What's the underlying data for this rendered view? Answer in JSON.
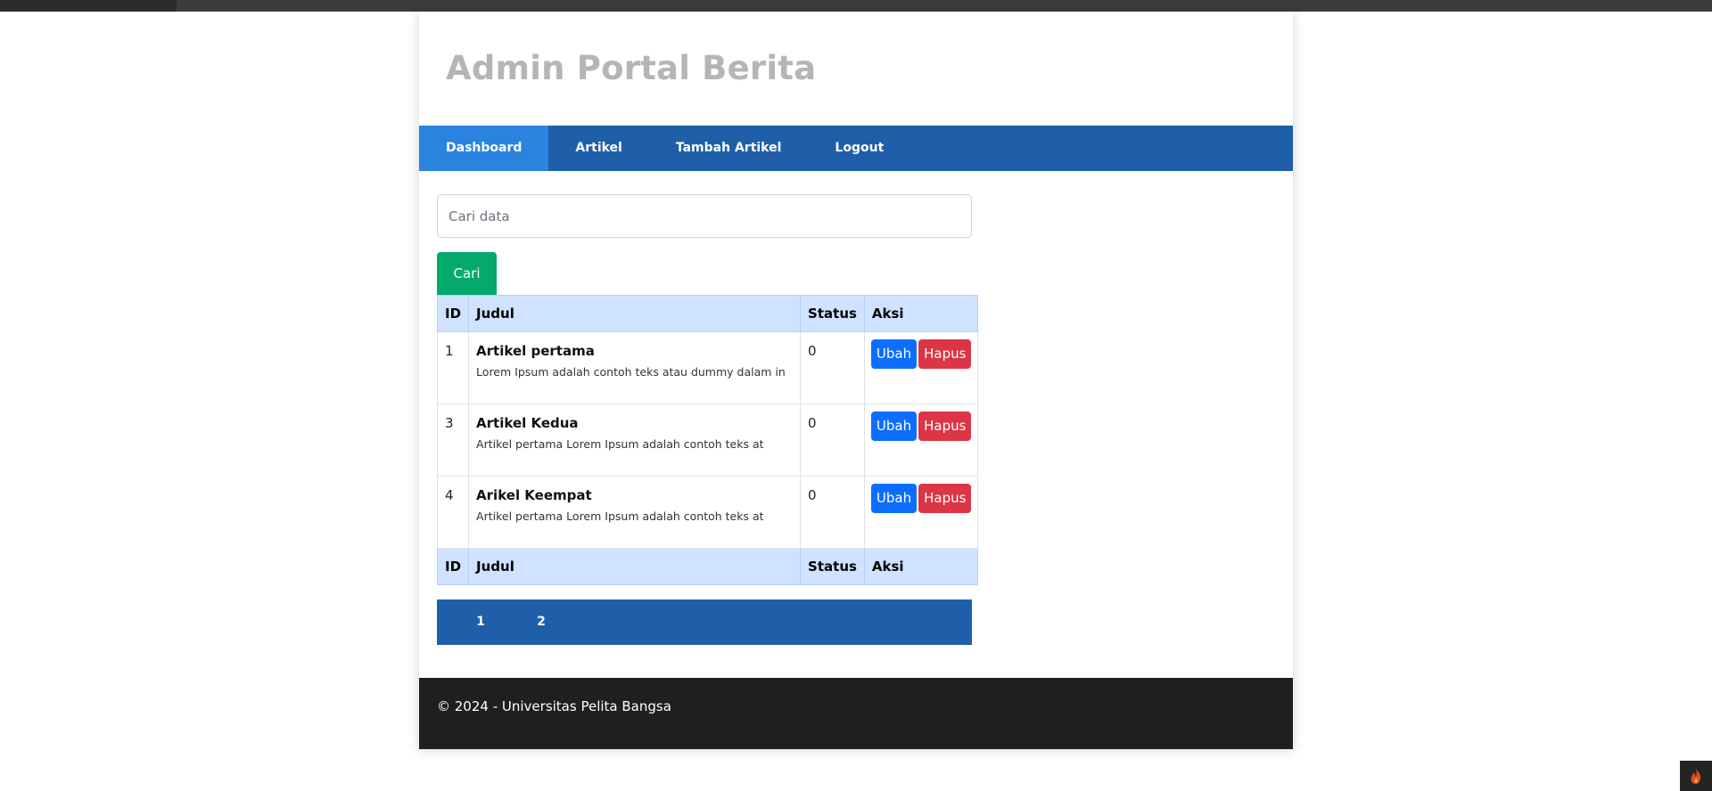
{
  "site": {
    "title": "Admin Portal Berita"
  },
  "nav": {
    "items": [
      {
        "label": "Dashboard",
        "active": true
      },
      {
        "label": "Artikel",
        "active": false
      },
      {
        "label": "Tambah Artikel",
        "active": false
      },
      {
        "label": "Logout",
        "active": false
      }
    ]
  },
  "search": {
    "placeholder": "Cari data",
    "value": "",
    "button_label": "Cari"
  },
  "table": {
    "columns": [
      "ID",
      "Judul",
      "Status",
      "Aksi"
    ],
    "rows": [
      {
        "id": "1",
        "title": "Artikel pertama",
        "excerpt": "Lorem Ipsum adalah contoh teks atau dummy dalam in",
        "status": "0",
        "edit_label": "Ubah",
        "delete_label": "Hapus"
      },
      {
        "id": "3",
        "title": "Artikel Kedua",
        "excerpt": "Artikel pertama Lorem Ipsum adalah contoh teks at",
        "status": "0",
        "edit_label": "Ubah",
        "delete_label": "Hapus"
      },
      {
        "id": "4",
        "title": "Arikel Keempat",
        "excerpt": "Artikel pertama Lorem Ipsum adalah contoh teks at",
        "status": "0",
        "edit_label": "Ubah",
        "delete_label": "Hapus"
      }
    ]
  },
  "pagination": {
    "pages": [
      "1",
      "2"
    ]
  },
  "footer": {
    "text": "© 2024 - Universitas Pelita Bangsa"
  },
  "colors": {
    "nav_bg": "#1f5faa",
    "nav_active": "#2b83e0",
    "search_button": "#04a96b",
    "table_header": "#cfe2ff",
    "edit_button": "#0d6efd",
    "delete_button": "#dc3545",
    "footer_bg": "#1f1f1f"
  },
  "icons": {
    "corner_badge": "flame-icon"
  }
}
